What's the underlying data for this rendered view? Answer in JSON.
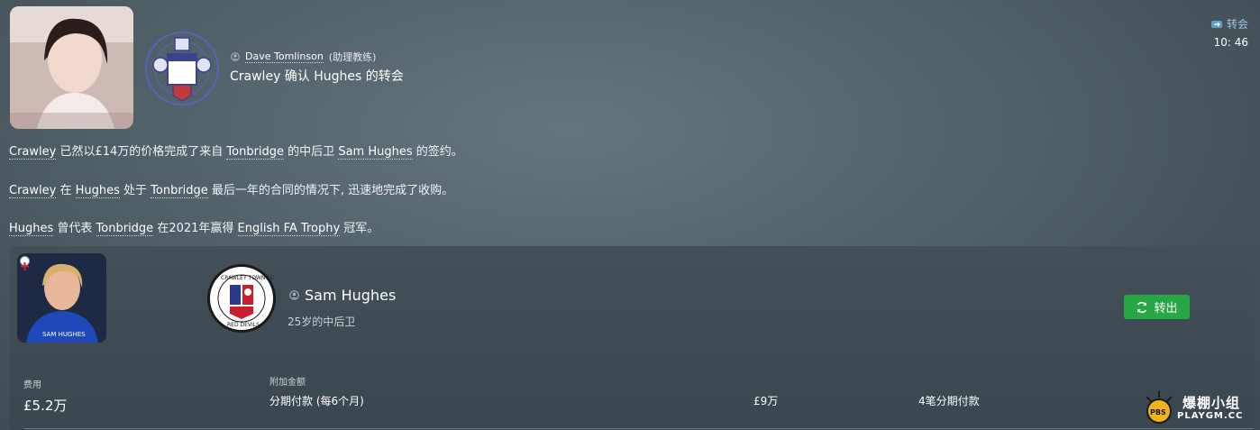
{
  "message": {
    "sender_name": "Dave Tomlinson",
    "sender_role": "(助理教练)",
    "headline": "Crawley 确认 Hughes 的转会",
    "category": "转会",
    "time": "10: 46",
    "crest_text": "Tonbridge Angels Football Club"
  },
  "body": {
    "p1": {
      "t1": "Crawley",
      "t2": " 已然以£14万的价格完成了来自 ",
      "t3": "Tonbridge",
      "t4": " 的中后卫 ",
      "t5": "Sam Hughes",
      "t6": " 的签约。"
    },
    "p2": {
      "t1": "Crawley",
      "t2": " 在 ",
      "t3": "Hughes",
      "t4": " 处于 ",
      "t5": "Tonbridge",
      "t6": " 最后一年的合同的情况下, 迅速地完成了收购。"
    },
    "p3": {
      "t1": "Hughes",
      "t2": " 曾代表 ",
      "t3": "Tonbridge",
      "t4": " 在2021年赢得 ",
      "t5": "English FA Trophy",
      "t6": " 冠军。"
    }
  },
  "player": {
    "name": "Sam Hughes",
    "description": "25岁的中后卫",
    "shirt_name": "SAM HUGHES",
    "new_club_crest_top": "CRAWLEY TOWN FC",
    "new_club_crest_bottom": "RED DEVILS",
    "action_label": "转出",
    "fee_label": "费用",
    "fee_value": "£5.2万",
    "extra_label": "附加金额",
    "extra_desc": "分期付款 (每6个月)",
    "extra_amount": "£9万",
    "extra_detail": "4笔分期付款"
  },
  "watermark": {
    "line1": "爆棚小组",
    "line2": "PLAYGM.CC",
    "badge": "PBS"
  },
  "colors": {
    "action_green": "#27a745",
    "category_blue": "#9ec5df"
  }
}
